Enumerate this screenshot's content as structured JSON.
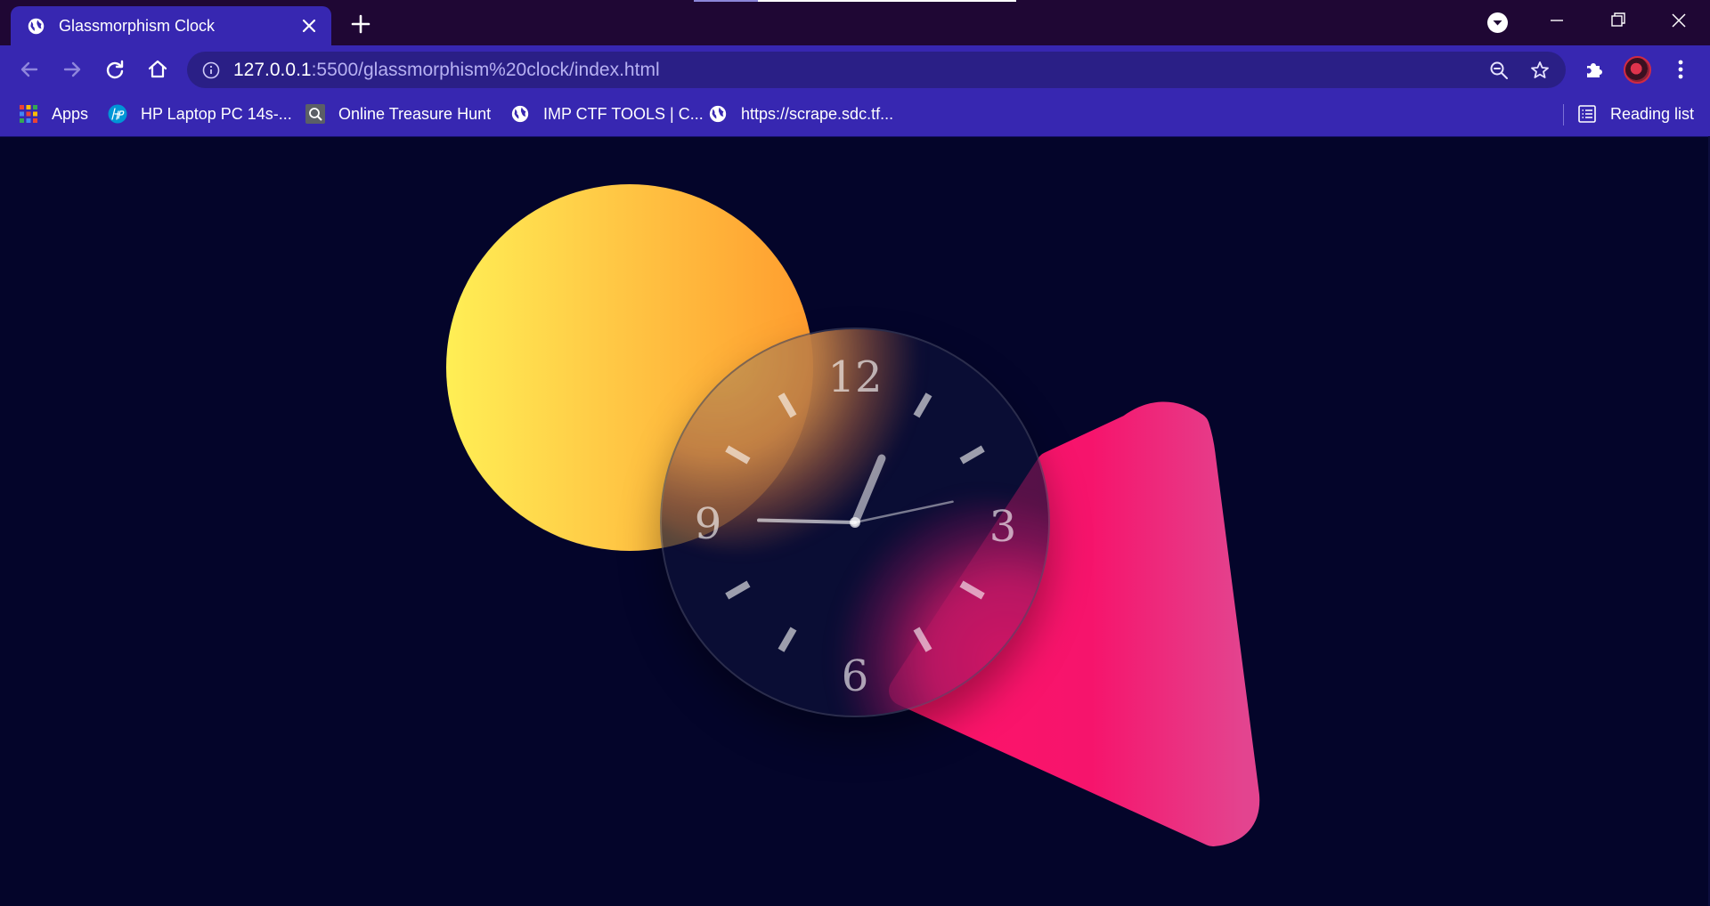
{
  "tab": {
    "title": "Glassmorphism Clock"
  },
  "address_bar": {
    "host": "127.0.0.1",
    "path": ":5500/glassmorphism%20clock/index.html"
  },
  "bookmarks": {
    "apps": "Apps",
    "hp": "HP Laptop PC 14s-...",
    "treasure": "Online Treasure Hunt",
    "ctf": "IMP CTF TOOLS | C...",
    "scrape": "https://scrape.sdc.tf...",
    "reading_list": "Reading list"
  },
  "clock": {
    "numerals": {
      "twelve": "12",
      "three": "3",
      "six": "6",
      "nine": "9"
    },
    "time": {
      "hour": 12,
      "minute": 45,
      "second": 13
    }
  },
  "colors": {
    "page_background": "#04052a",
    "chrome_dark": "#1f0734",
    "chrome_accent": "#3727b1",
    "sun_gradient": [
      "#ffef55",
      "#ff9c2e"
    ],
    "triangle_gradient": [
      "#ff1469",
      "#e3448f"
    ]
  }
}
